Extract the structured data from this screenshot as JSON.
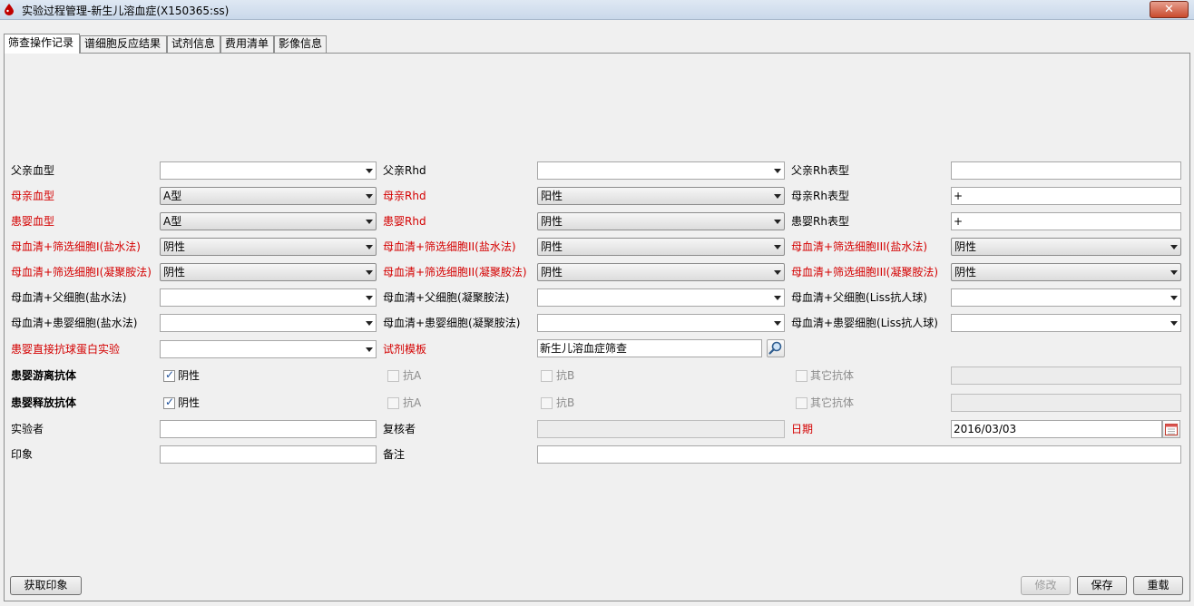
{
  "window": {
    "title": "实验过程管理-新生儿溶血症(X150365:ss)",
    "close_label": "✕"
  },
  "tabs": [
    {
      "label": "筛查操作记录"
    },
    {
      "label": "谱细胞反应结果"
    },
    {
      "label": "试剂信息"
    },
    {
      "label": "费用清单"
    },
    {
      "label": "影像信息"
    }
  ],
  "form": {
    "father_abo_label": "父亲血型",
    "father_abo_value": "",
    "father_rhd_label": "父亲Rhd",
    "father_rhd_value": "",
    "father_rh_pheno_label": "父亲Rh表型",
    "father_rh_pheno_value": "",
    "mother_abo_label": "母亲血型",
    "mother_abo_value": "A型",
    "mother_rhd_label": "母亲Rhd",
    "mother_rhd_value": "阳性",
    "mother_rh_pheno_label": "母亲Rh表型",
    "mother_rh_pheno_value": "+",
    "child_abo_label": "患婴血型",
    "child_abo_value": "A型",
    "child_rhd_label": "患婴Rhd",
    "child_rhd_value": "阴性",
    "child_rh_pheno_label": "患婴Rh表型",
    "child_rh_pheno_value": "+",
    "s1_saline_label": "母血清+筛选细胞I(盐水法)",
    "s1_saline_value": "阴性",
    "s2_saline_label": "母血清+筛选细胞II(盐水法)",
    "s2_saline_value": "阴性",
    "s3_saline_label": "母血清+筛选细胞III(盐水法)",
    "s3_saline_value": "阴性",
    "s1_poly_label": "母血清+筛选细胞I(凝聚胺法)",
    "s1_poly_value": "阴性",
    "s2_poly_label": "母血清+筛选细胞II(凝聚胺法)",
    "s2_poly_value": "阴性",
    "s3_poly_label": "母血清+筛选细胞III(凝聚胺法)",
    "s3_poly_value": "阴性",
    "father_saline_label": "母血清+父细胞(盐水法)",
    "father_saline_value": "",
    "father_poly_label": "母血清+父细胞(凝聚胺法)",
    "father_poly_value": "",
    "father_liss_label": "母血清+父细胞(Liss抗人球)",
    "father_liss_value": "",
    "child_saline_label": "母血清+患婴细胞(盐水法)",
    "child_saline_value": "",
    "child_poly_label": "母血清+患婴细胞(凝聚胺法)",
    "child_poly_value": "",
    "child_liss_label": "母血清+患婴细胞(Liss抗人球)",
    "child_liss_value": "",
    "dat_label": "患婴直接抗球蛋白实验",
    "dat_value": "",
    "reagent_template_label": "试剂模板",
    "reagent_template_value": "新生儿溶血症筛查",
    "free_ab_label": "患婴游离抗体",
    "release_ab_label": "患婴释放抗体",
    "negative_label": "阴性",
    "anti_a_label": "抗A",
    "anti_b_label": "抗B",
    "other_ab_label": "其它抗体",
    "tester_label": "实验者",
    "tester_value": "",
    "reviewer_label": "复核者",
    "reviewer_value": "",
    "date_label": "日期",
    "date_value": "2016/03/03",
    "impression_label": "印象",
    "impression_value": "",
    "remark_label": "备注",
    "remark_value": ""
  },
  "buttons": {
    "get_impression": "获取印象",
    "modify": "修改",
    "save": "保存",
    "reload": "重载"
  },
  "checkboxes": {
    "free_negative": true,
    "free_anti_a": false,
    "free_anti_b": false,
    "free_other": false,
    "release_negative": true,
    "release_anti_a": false,
    "release_anti_b": false,
    "release_other": false
  },
  "colors": {
    "required_label": "#d40000",
    "accent": "#1d4f9a"
  }
}
